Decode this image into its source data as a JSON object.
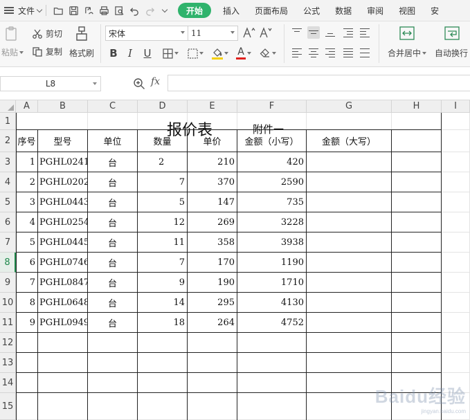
{
  "menu": {
    "file_label": "文件",
    "tabs": [
      "开始",
      "插入",
      "页面布局",
      "公式",
      "数据",
      "审阅",
      "视图",
      "安"
    ],
    "active_tab": "开始"
  },
  "ribbon": {
    "paste_label": "粘贴",
    "cut_label": "剪切",
    "copy_label": "复制",
    "format_painter_label": "格式刷",
    "font_name": "宋体",
    "font_size": "11",
    "merge_center_label": "合并居中",
    "auto_wrap_label": "自动换行",
    "font_color": "#e0201d",
    "fill_color": "#f5d000",
    "accent": "#2fb36c"
  },
  "formula_bar": {
    "name_box": "L8",
    "fx_label": "fx",
    "formula": ""
  },
  "sheet": {
    "columns": [
      "A",
      "B",
      "C",
      "D",
      "E",
      "F",
      "G",
      "H",
      "I"
    ],
    "rows": [
      "1",
      "2",
      "3",
      "4",
      "5",
      "6",
      "7",
      "8",
      "9",
      "10",
      "11",
      "12",
      "13",
      "14",
      "15"
    ],
    "active_row": "8",
    "title": "报价表",
    "subtitle": "附件一",
    "headers": [
      "序号",
      "型号",
      "单位",
      "数量",
      "单价",
      "金额（小写）",
      "金额（大写）"
    ],
    "data_rows": [
      {
        "no": "1",
        "model": "PGHL0241",
        "unit": "台",
        "qty": "2",
        "price": "210",
        "amount": "420"
      },
      {
        "no": "2",
        "model": "PGHL0202",
        "unit": "台",
        "qty": "7",
        "price": "370",
        "amount": "2590"
      },
      {
        "no": "3",
        "model": "PGHL0443",
        "unit": "台",
        "qty": "5",
        "price": "147",
        "amount": "735"
      },
      {
        "no": "4",
        "model": "PGHL0254",
        "unit": "台",
        "qty": "12",
        "price": "269",
        "amount": "3228"
      },
      {
        "no": "5",
        "model": "PGHL0445",
        "unit": "台",
        "qty": "11",
        "price": "358",
        "amount": "3938"
      },
      {
        "no": "6",
        "model": "PGHL0746",
        "unit": "台",
        "qty": "7",
        "price": "170",
        "amount": "1190"
      },
      {
        "no": "7",
        "model": "PGHL0847",
        "unit": "台",
        "qty": "9",
        "price": "190",
        "amount": "1710"
      },
      {
        "no": "8",
        "model": "PGHL0648",
        "unit": "台",
        "qty": "14",
        "price": "295",
        "amount": "4130"
      },
      {
        "no": "9",
        "model": "PGHL0949",
        "unit": "台",
        "qty": "18",
        "price": "264",
        "amount": "4752"
      }
    ]
  },
  "watermark": {
    "main": "Baidu经验",
    "sub": "jingyan.baidu.com"
  }
}
